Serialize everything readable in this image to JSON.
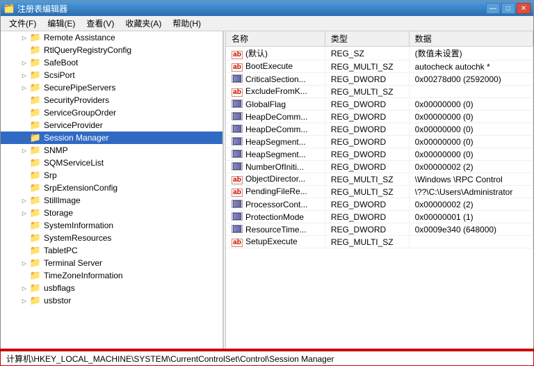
{
  "window": {
    "title": "注册表编辑器",
    "icon": "🗂️"
  },
  "menu": {
    "items": [
      {
        "label": "文件(F)"
      },
      {
        "label": "编辑(E)"
      },
      {
        "label": "查看(V)"
      },
      {
        "label": "收藏夹(A)"
      },
      {
        "label": "帮助(H)"
      }
    ]
  },
  "tree": {
    "items": [
      {
        "label": "Remote Assistance",
        "indent": 1,
        "hasArrow": true,
        "selected": false
      },
      {
        "label": "RtlQueryRegistryConfig",
        "indent": 1,
        "hasArrow": false,
        "selected": false
      },
      {
        "label": "SafeBoot",
        "indent": 1,
        "hasArrow": true,
        "selected": false
      },
      {
        "label": "ScsiPort",
        "indent": 1,
        "hasArrow": true,
        "selected": false
      },
      {
        "label": "SecurePipeServers",
        "indent": 1,
        "hasArrow": true,
        "selected": false
      },
      {
        "label": "SecurityProviders",
        "indent": 1,
        "hasArrow": false,
        "selected": false
      },
      {
        "label": "ServiceGroupOrder",
        "indent": 1,
        "hasArrow": false,
        "selected": false
      },
      {
        "label": "ServiceProvider",
        "indent": 1,
        "hasArrow": false,
        "selected": false
      },
      {
        "label": "Session Manager",
        "indent": 1,
        "hasArrow": true,
        "selected": true
      },
      {
        "label": "SNMP",
        "indent": 1,
        "hasArrow": true,
        "selected": false
      },
      {
        "label": "SQMServiceList",
        "indent": 1,
        "hasArrow": false,
        "selected": false
      },
      {
        "label": "Srp",
        "indent": 1,
        "hasArrow": false,
        "selected": false
      },
      {
        "label": "SrpExtensionConfig",
        "indent": 1,
        "hasArrow": false,
        "selected": false
      },
      {
        "label": "StillImage",
        "indent": 1,
        "hasArrow": true,
        "selected": false
      },
      {
        "label": "Storage",
        "indent": 1,
        "hasArrow": true,
        "selected": false
      },
      {
        "label": "SystemInformation",
        "indent": 1,
        "hasArrow": false,
        "selected": false
      },
      {
        "label": "SystemResources",
        "indent": 1,
        "hasArrow": false,
        "selected": false
      },
      {
        "label": "TabletPC",
        "indent": 1,
        "hasArrow": false,
        "selected": false
      },
      {
        "label": "Terminal Server",
        "indent": 1,
        "hasArrow": true,
        "selected": false
      },
      {
        "label": "TimeZoneInformation",
        "indent": 1,
        "hasArrow": false,
        "selected": false
      },
      {
        "label": "usbflags",
        "indent": 1,
        "hasArrow": true,
        "selected": false
      },
      {
        "label": "usbstor",
        "indent": 1,
        "hasArrow": true,
        "selected": false
      }
    ]
  },
  "registry_table": {
    "headers": [
      "名称",
      "类型",
      "数据"
    ],
    "rows": [
      {
        "icon": "ab",
        "name": "(默认)",
        "type": "REG_SZ",
        "data": "(数值未设置)"
      },
      {
        "icon": "ab",
        "name": "BootExecute",
        "type": "REG_MULTI_SZ",
        "data": "autocheck autochk *"
      },
      {
        "icon": "dword",
        "name": "CriticalSection...",
        "type": "REG_DWORD",
        "data": "0x00278d00 (2592000)"
      },
      {
        "icon": "ab",
        "name": "ExcludeFromK...",
        "type": "REG_MULTI_SZ",
        "data": ""
      },
      {
        "icon": "dword",
        "name": "GlobalFlag",
        "type": "REG_DWORD",
        "data": "0x00000000 (0)"
      },
      {
        "icon": "dword",
        "name": "HeapDeComm...",
        "type": "REG_DWORD",
        "data": "0x00000000 (0)"
      },
      {
        "icon": "dword",
        "name": "HeapDeComm...",
        "type": "REG_DWORD",
        "data": "0x00000000 (0)"
      },
      {
        "icon": "dword",
        "name": "HeapSegment...",
        "type": "REG_DWORD",
        "data": "0x00000000 (0)"
      },
      {
        "icon": "dword",
        "name": "HeapSegment...",
        "type": "REG_DWORD",
        "data": "0x00000000 (0)"
      },
      {
        "icon": "dword",
        "name": "NumberOfIniti...",
        "type": "REG_DWORD",
        "data": "0x00000002 (2)"
      },
      {
        "icon": "ab",
        "name": "ObjectDirector...",
        "type": "REG_MULTI_SZ",
        "data": "\\Windows \\RPC Control"
      },
      {
        "icon": "ab",
        "name": "PendingFileRe...",
        "type": "REG_MULTI_SZ",
        "data": "\\??\\C:\\Users\\Administrator"
      },
      {
        "icon": "dword",
        "name": "ProcessorCont...",
        "type": "REG_DWORD",
        "data": "0x00000002 (2)"
      },
      {
        "icon": "dword",
        "name": "ProtectionMode",
        "type": "REG_DWORD",
        "data": "0x00000001 (1)"
      },
      {
        "icon": "dword",
        "name": "ResourceTime...",
        "type": "REG_DWORD",
        "data": "0x0009e340 (648000)"
      },
      {
        "icon": "ab",
        "name": "SetupExecute",
        "type": "REG_MULTI_SZ",
        "data": ""
      }
    ]
  },
  "status_bar": {
    "path": "计算机\\HKEY_LOCAL_MACHINE\\SYSTEM\\CurrentControlSet\\Control\\Session Manager"
  },
  "title_buttons": {
    "minimize": "—",
    "maximize": "□",
    "close": "✕"
  }
}
